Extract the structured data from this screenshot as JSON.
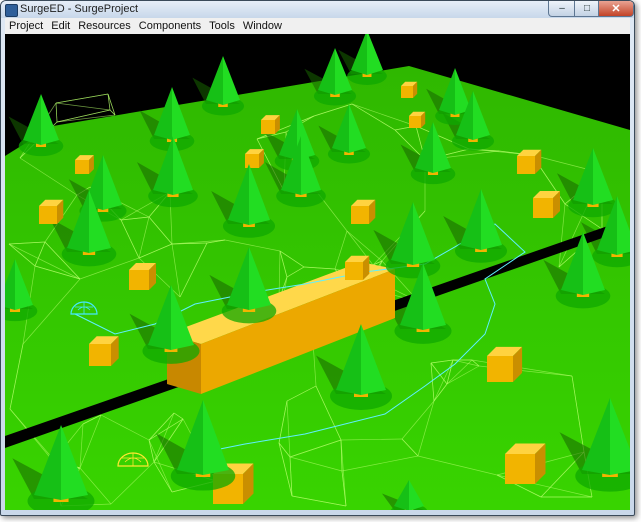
{
  "window": {
    "title": "SurgeED - SurgeProject",
    "controls": {
      "minimize": "–",
      "maximize": "□",
      "close": "✕"
    }
  },
  "menubar": {
    "items": [
      {
        "label": "Project"
      },
      {
        "label": "Edit"
      },
      {
        "label": "Resources"
      },
      {
        "label": "Components"
      },
      {
        "label": "Tools"
      },
      {
        "label": "Window"
      }
    ]
  },
  "colors": {
    "terrain": "#32c800",
    "tree": "#22dd22",
    "crate": "#f2b400",
    "wall": "#f5b800",
    "road": "#000000",
    "navmesh_lines": "#b6ff6a",
    "path_line": "#5ef0ff",
    "cyan_marker": "#44e8ff",
    "yellow_marker": "#ffe830"
  },
  "viewport": {
    "icons": [
      "tree-icon",
      "crate-icon",
      "wall-icon",
      "road-icon",
      "waypoint-marker-icon"
    ]
  }
}
